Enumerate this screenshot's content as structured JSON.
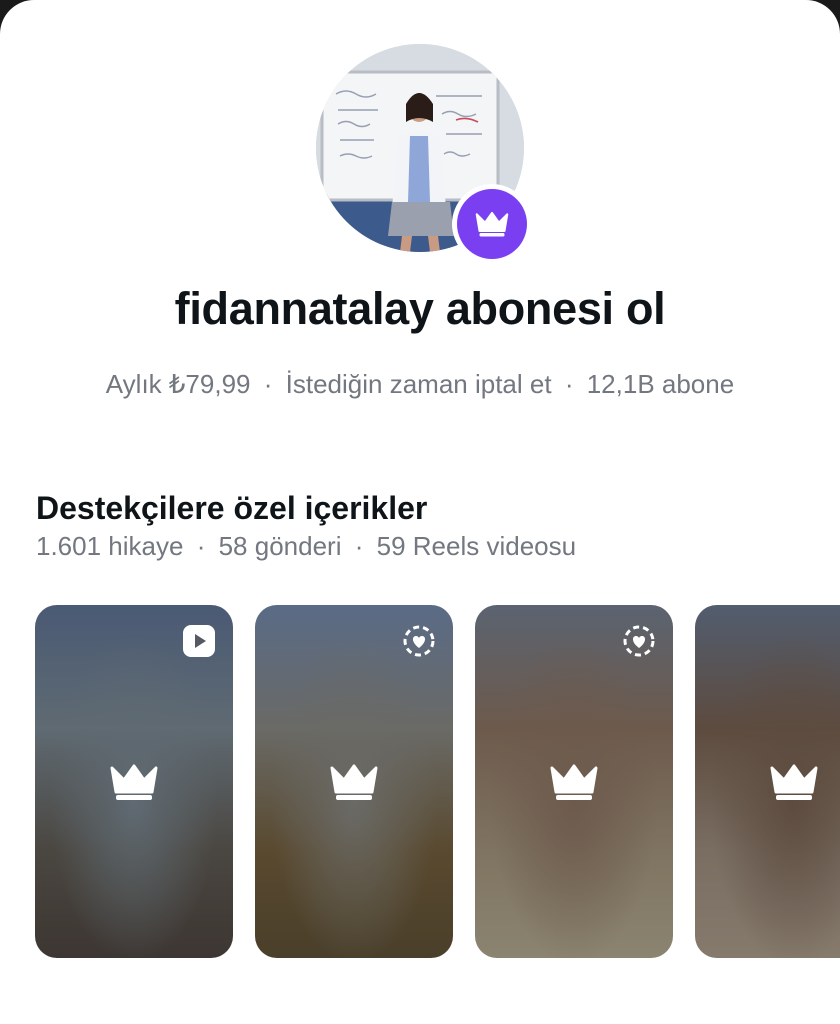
{
  "profile": {
    "avatar_alt": "profil fotoğrafı",
    "badge_icon": "crown-icon",
    "badge_color": "#7b3ff2"
  },
  "header": {
    "title": "fidannatalay abonesi ol",
    "price": "Aylık ₺79,99",
    "cancel": "İstediğin zaman iptal et",
    "subscribers": "12,1B abone",
    "separator": "·"
  },
  "section": {
    "title": "Destekçilere özel içerikler",
    "stories": "1.601 hikaye",
    "posts": "58 gönderi",
    "reels": "59 Reels videosu",
    "separator": "·"
  },
  "cards": [
    {
      "type_icon": "reels-play-icon",
      "center_icon": "crown-icon",
      "colors": [
        "#4a5a74",
        "#5f6a72",
        "#4a4640",
        "#3d3632"
      ]
    },
    {
      "type_icon": "close-friends-story-icon",
      "center_icon": "crown-icon",
      "colors": [
        "#5a6b86",
        "#6a6a66",
        "#59492f",
        "#4a3f2a"
      ]
    },
    {
      "type_icon": "close-friends-story-icon",
      "center_icon": "crown-icon",
      "colors": [
        "#5b6370",
        "#6d5a4c",
        "#7f7461",
        "#8b8470"
      ]
    },
    {
      "type_icon": "",
      "center_icon": "crown-icon",
      "colors": [
        "#525d6e",
        "#5d4b3f",
        "#7a6e62",
        "#857a6c"
      ]
    }
  ]
}
